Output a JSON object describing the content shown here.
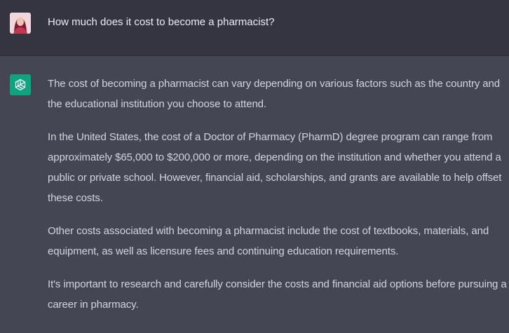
{
  "user": {
    "avatar_icon": "user-photo-avatar",
    "question": "How much does it cost to become a pharmacist?"
  },
  "assistant": {
    "avatar_icon": "openai-logo-icon",
    "avatar_color": "#10a37f",
    "paragraphs": [
      "The cost of becoming a pharmacist can vary depending on various factors such as the country and the educational institution you choose to attend.",
      "In the United States, the cost of a Doctor of Pharmacy (PharmD) degree program can range from approximately $65,000 to $200,000 or more, depending on the institution and whether you attend a public or private school. However, financial aid, scholarships, and grants are available to help offset these costs.",
      "Other costs associated with becoming a pharmacist include the cost of textbooks, materials, and equipment, as well as licensure fees and continuing education requirements.",
      "It's important to research and carefully consider the costs and financial aid options before pursuing a career in pharmacy."
    ]
  },
  "colors": {
    "user_bg": "#343541",
    "assistant_bg": "#444654",
    "text_primary": "#ececf1",
    "text_secondary": "#d1d5db"
  }
}
